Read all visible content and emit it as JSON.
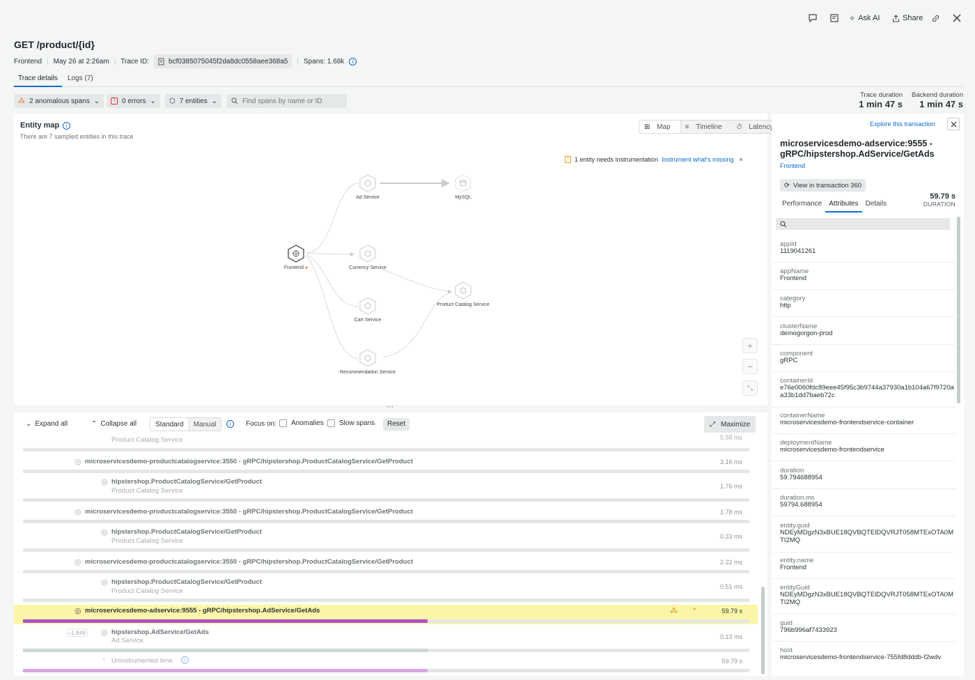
{
  "toolbar": {
    "ask_ai": "Ask AI",
    "share": "Share"
  },
  "header": {
    "title": "GET /product/{id}",
    "entity": "Frontend",
    "timestamp": "May 26 at 2:26am",
    "trace_id_label": "Trace ID:",
    "trace_id": "bcf0385075045f2da8dc0558aee368a5",
    "spans": "Spans: 1.68k"
  },
  "tabs": [
    {
      "label": "Trace details",
      "active": true
    },
    {
      "label": "Logs (7)",
      "active": false
    }
  ],
  "filters": {
    "anomalous": "2 anomalous spans",
    "errors": "0 errors",
    "entities": "7 entities",
    "search_placeholder": "Find spans by name or ID"
  },
  "durations": {
    "trace_label": "Trace duration",
    "trace_value": "1 min 47 s",
    "backend_label": "Backend duration",
    "backend_value": "1 min 47 s"
  },
  "entity_map": {
    "title": "Entity map",
    "subtitle": "There are 7 sampled entities in this trace",
    "views": [
      "Map",
      "Timeline",
      "Latency"
    ],
    "notice": "1 entity needs instrumentation",
    "notice_link": "Instrument what's missing",
    "nodes": {
      "frontend": "Frontend",
      "ad": "Ad Service",
      "mysql": "MySQL",
      "currency": "Currency Service",
      "catalog": "Product Catalog Service",
      "cart": "Cart Service",
      "recommendation": "Recommendation Service"
    },
    "colors": {
      "accent": "#e8772e",
      "link": "#0b6acb"
    }
  },
  "spans_toolbar": {
    "expand_all": "Expand all",
    "collapse_all": "Collapse all",
    "mode_standard": "Standard",
    "mode_manual": "Manual",
    "focus_on": "Focus on:",
    "anomalies": "Anomalies",
    "slow_spans": "Slow spans",
    "reset": "Reset",
    "maximize": "Maximize"
  },
  "spans": {
    "top_sub": "Product Catalog Service",
    "top_dur": "5.58 ms",
    "r1": {
      "name": "microservicesdemo-productcatalogservice:3550 - gRPC/hipstershop.ProductCatalogService/GetProduct",
      "dur": "3.16 ms"
    },
    "r2": {
      "name": "hipstershop.ProductCatalogService/GetProduct",
      "sub": "Product Catalog Service",
      "dur": "1.76 ms"
    },
    "r3": {
      "name": "microservicesdemo-productcatalogservice:3550 - gRPC/hipstershop.ProductCatalogService/GetProduct",
      "dur": "1.78 ms"
    },
    "r4": {
      "name": "hipstershop.ProductCatalogService/GetProduct",
      "sub": "Product Catalog Service",
      "dur": "0.33 ms"
    },
    "r5": {
      "name": "microservicesdemo-productcatalogservice:3550 - gRPC/hipstershop.ProductCatalogService/GetProduct",
      "dur": "2.22 ms"
    },
    "r6": {
      "name": "hipstershop.ProductCatalogService/GetProduct",
      "sub": "Product Catalog Service",
      "dur": "0.51 ms"
    },
    "r7": {
      "name": "microservicesdemo-adservice:9555 - gRPC/hipstershop.AdService/GetAds",
      "dur": "59.79 s"
    },
    "r8": {
      "badge": "›1,649",
      "name": "hipstershop.AdService/GetAds",
      "sub": "Ad Service",
      "dur": "0.13 ms"
    },
    "r9": {
      "name": "Uninstrumented time",
      "dur": "59.79 s"
    },
    "colors": {
      "selected_bg": "#fbf6a7",
      "selected_bar": "#b04fd0",
      "uninstrumented_bar": "#d7a6e4"
    }
  },
  "detail": {
    "explore_link": "Explore this transaction",
    "title": "microservicesdemo-adservice:9555 - gRPC/hipstershop.AdService/GetAds",
    "entity": "Frontend",
    "view_in_txn": "View in transaction 360",
    "duration_value": "59.79 s",
    "duration_label": "DURATION",
    "tabs": [
      "Performance",
      "Attributes",
      "Details"
    ],
    "attributes": [
      {
        "k": "appId",
        "v": "1119041261"
      },
      {
        "k": "appName",
        "v": "Frontend"
      },
      {
        "k": "category",
        "v": "http"
      },
      {
        "k": "clusterName",
        "v": "demogorgon-prod"
      },
      {
        "k": "component",
        "v": "gRPC"
      },
      {
        "k": "containerId",
        "v": "e76e0060fdc89eee45f95c3b9744a37930a1b104a67f9720aa33b1dd7baeb72c"
      },
      {
        "k": "containerName",
        "v": "microservicesdemo-frontendservice-container"
      },
      {
        "k": "deploymentName",
        "v": "microservicesdemo-frontendservice"
      },
      {
        "k": "duration",
        "v": "59.794688954"
      },
      {
        "k": "duration.ms",
        "v": "59794.688954"
      },
      {
        "k": "entity.guid",
        "v": "NDEyMDgzN3xBUE18QVBQTElDQVRJT058MTExOTA0MTI2MQ"
      },
      {
        "k": "entity.name",
        "v": "Frontend"
      },
      {
        "k": "entityGuid",
        "v": "NDEyMDgzN3xBUE18QVBQTElDQVRJT058MTExOTA0MTI2MQ"
      },
      {
        "k": "guid",
        "v": "796b996af7433923"
      },
      {
        "k": "host",
        "v": "microservicesdemo-frontendservice-755fd8dddb-f2wdv"
      }
    ]
  }
}
